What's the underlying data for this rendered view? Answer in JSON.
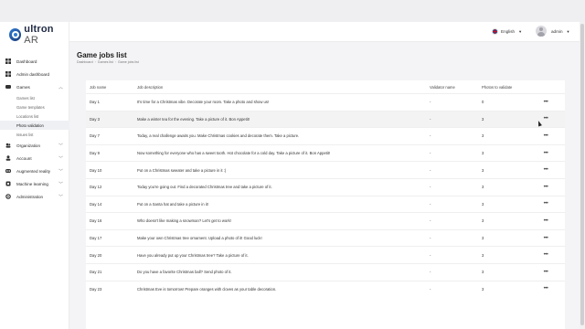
{
  "app": {
    "logo_main": "ultron",
    "logo_sub": "AR"
  },
  "header": {
    "language": "English",
    "user_name": "admin"
  },
  "sidebar": {
    "items": [
      {
        "label": "Dashboard",
        "icon": "dashboard-icon"
      },
      {
        "label": "Admin dashboard",
        "icon": "admin-dashboard-icon"
      },
      {
        "label": "Games",
        "icon": "games-icon",
        "expanded": true
      }
    ],
    "games_sub": [
      "Games list",
      "Game templates",
      "Locations list",
      "Photo validation",
      "Issues list"
    ],
    "more": [
      {
        "label": "Organization",
        "icon": "organization-icon"
      },
      {
        "label": "Account",
        "icon": "account-icon"
      },
      {
        "label": "Augmented reality",
        "icon": "augmented-reality-icon"
      },
      {
        "label": "Machine learning",
        "icon": "machine-learning-icon"
      },
      {
        "label": "Administration",
        "icon": "administration-icon"
      }
    ]
  },
  "page": {
    "title": "Game jobs list",
    "breadcrumb": [
      "Dashboard",
      "Games list",
      "Game jobs list"
    ]
  },
  "table": {
    "headers": [
      "Job name",
      "Job description",
      "Validator name",
      "Photos to validate"
    ],
    "rows": [
      {
        "job": "Day 1",
        "desc": "It's time for a Christmas vibe. Decorate your room. Take a photo and show us!",
        "validator": "-",
        "photos": "0"
      },
      {
        "job": "Day 3",
        "desc": "Make a winter tea for the evening. Take a picture of it. Bon Appetit!",
        "validator": "-",
        "photos": "3"
      },
      {
        "job": "Day 7",
        "desc": "Today, a real challenge awaits you. Make Christmas cookies and decorate them. Take a picture.",
        "validator": "-",
        "photos": "3"
      },
      {
        "job": "Day 9",
        "desc": "Now something for everyone who has a sweet tooth. Hot chocolate for a cold day. Take a picture of it. Bon Appetit!",
        "validator": "-",
        "photos": "3"
      },
      {
        "job": "Day 10",
        "desc": "Put on a Christmas sweater and take a picture in it :)",
        "validator": "-",
        "photos": "3"
      },
      {
        "job": "Day 12",
        "desc": "Today you're going out. Find a decorated Christmas tree and take a picture of it.",
        "validator": "-",
        "photos": "3"
      },
      {
        "job": "Day 14",
        "desc": "Put on a Santa hat and take a picture in it!",
        "validator": "-",
        "photos": "3"
      },
      {
        "job": "Day 16",
        "desc": "Who doesn't like making a snowman? Let's get to work!",
        "validator": "-",
        "photos": "3"
      },
      {
        "job": "Day 17",
        "desc": "Make your own Christmas tree ornament. Upload a photo of it! Good luck!",
        "validator": "-",
        "photos": "3"
      },
      {
        "job": "Day 20",
        "desc": "Have you already put up your Christmas tree? Take a picture of it.",
        "validator": "-",
        "photos": "3"
      },
      {
        "job": "Day 21",
        "desc": "Do you have a favorite Christmas ball? Send photo of it.",
        "validator": "-",
        "photos": "3"
      },
      {
        "job": "Day 23",
        "desc": "Christmas Eve is tomorrow! Prepare oranges with cloves as your table decoration.",
        "validator": "-",
        "photos": "3"
      }
    ],
    "action_glyph": "•••"
  }
}
